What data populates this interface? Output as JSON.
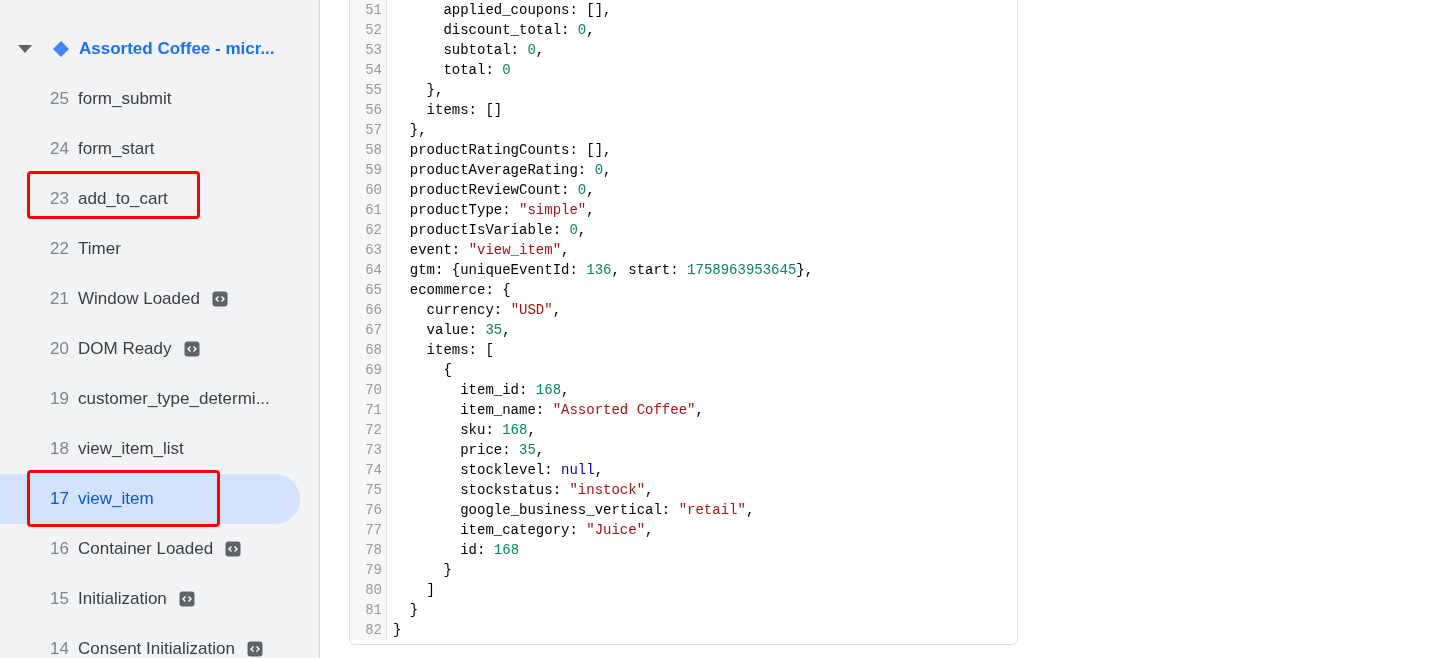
{
  "sidebar": {
    "items": [
      {
        "kind": "group",
        "label": "Assorted Coffee - micr...",
        "expanded": true
      },
      {
        "kind": "event",
        "number": "25",
        "label": "form_submit",
        "selected": false,
        "annotated": false,
        "code_icon": false
      },
      {
        "kind": "event",
        "number": "24",
        "label": "form_start",
        "selected": false,
        "annotated": false,
        "code_icon": false
      },
      {
        "kind": "event",
        "number": "23",
        "label": "add_to_cart",
        "selected": false,
        "annotated": true,
        "code_icon": false
      },
      {
        "kind": "event",
        "number": "22",
        "label": "Timer",
        "selected": false,
        "annotated": false,
        "code_icon": false
      },
      {
        "kind": "event",
        "number": "21",
        "label": "Window Loaded",
        "selected": false,
        "annotated": false,
        "code_icon": true
      },
      {
        "kind": "event",
        "number": "20",
        "label": "DOM Ready",
        "selected": false,
        "annotated": false,
        "code_icon": true
      },
      {
        "kind": "event",
        "number": "19",
        "label": "customer_type_determi...",
        "selected": false,
        "annotated": false,
        "code_icon": false
      },
      {
        "kind": "event",
        "number": "18",
        "label": "view_item_list",
        "selected": false,
        "annotated": false,
        "code_icon": false
      },
      {
        "kind": "event",
        "number": "17",
        "label": "view_item",
        "selected": true,
        "annotated": true,
        "code_icon": false
      },
      {
        "kind": "event",
        "number": "16",
        "label": "Container Loaded",
        "selected": false,
        "annotated": false,
        "code_icon": true
      },
      {
        "kind": "event",
        "number": "15",
        "label": "Initialization",
        "selected": false,
        "annotated": false,
        "code_icon": true
      },
      {
        "kind": "event",
        "number": "14",
        "label": "Consent Initialization",
        "selected": false,
        "annotated": false,
        "code_icon": true
      }
    ]
  },
  "code": {
    "lines": [
      {
        "n": "51",
        "tokens": [
          {
            "kind": "plain",
            "text": "      applied_coupons: [],"
          }
        ]
      },
      {
        "n": "52",
        "tokens": [
          {
            "kind": "plain",
            "text": "      discount_total: "
          },
          {
            "kind": "number",
            "text": "0"
          },
          {
            "kind": "plain",
            "text": ","
          }
        ]
      },
      {
        "n": "53",
        "tokens": [
          {
            "kind": "plain",
            "text": "      subtotal: "
          },
          {
            "kind": "number",
            "text": "0"
          },
          {
            "kind": "plain",
            "text": ","
          }
        ]
      },
      {
        "n": "54",
        "tokens": [
          {
            "kind": "plain",
            "text": "      total: "
          },
          {
            "kind": "number",
            "text": "0"
          }
        ]
      },
      {
        "n": "55",
        "tokens": [
          {
            "kind": "plain",
            "text": "    },"
          }
        ]
      },
      {
        "n": "56",
        "tokens": [
          {
            "kind": "plain",
            "text": "    items: []"
          }
        ]
      },
      {
        "n": "57",
        "tokens": [
          {
            "kind": "plain",
            "text": "  },"
          }
        ]
      },
      {
        "n": "58",
        "tokens": [
          {
            "kind": "plain",
            "text": "  productRatingCounts: [],"
          }
        ]
      },
      {
        "n": "59",
        "tokens": [
          {
            "kind": "plain",
            "text": "  productAverageRating: "
          },
          {
            "kind": "number",
            "text": "0"
          },
          {
            "kind": "plain",
            "text": ","
          }
        ]
      },
      {
        "n": "60",
        "tokens": [
          {
            "kind": "plain",
            "text": "  productReviewCount: "
          },
          {
            "kind": "number",
            "text": "0"
          },
          {
            "kind": "plain",
            "text": ","
          }
        ]
      },
      {
        "n": "61",
        "tokens": [
          {
            "kind": "plain",
            "text": "  productType: "
          },
          {
            "kind": "string",
            "text": "\"simple\""
          },
          {
            "kind": "plain",
            "text": ","
          }
        ]
      },
      {
        "n": "62",
        "tokens": [
          {
            "kind": "plain",
            "text": "  productIsVariable: "
          },
          {
            "kind": "number",
            "text": "0"
          },
          {
            "kind": "plain",
            "text": ","
          }
        ]
      },
      {
        "n": "63",
        "tokens": [
          {
            "kind": "plain",
            "text": "  event: "
          },
          {
            "kind": "string",
            "text": "\"view_item\""
          },
          {
            "kind": "plain",
            "text": ","
          }
        ]
      },
      {
        "n": "64",
        "tokens": [
          {
            "kind": "plain",
            "text": "  gtm: {uniqueEventId: "
          },
          {
            "kind": "number",
            "text": "136"
          },
          {
            "kind": "plain",
            "text": ", start: "
          },
          {
            "kind": "number",
            "text": "1758963953645"
          },
          {
            "kind": "plain",
            "text": "},"
          }
        ]
      },
      {
        "n": "65",
        "tokens": [
          {
            "kind": "plain",
            "text": "  ecommerce: {"
          }
        ]
      },
      {
        "n": "66",
        "tokens": [
          {
            "kind": "plain",
            "text": "    currency: "
          },
          {
            "kind": "string",
            "text": "\"USD\""
          },
          {
            "kind": "plain",
            "text": ","
          }
        ]
      },
      {
        "n": "67",
        "tokens": [
          {
            "kind": "plain",
            "text": "    value: "
          },
          {
            "kind": "number",
            "text": "35"
          },
          {
            "kind": "plain",
            "text": ","
          }
        ]
      },
      {
        "n": "68",
        "tokens": [
          {
            "kind": "plain",
            "text": "    items: ["
          }
        ]
      },
      {
        "n": "69",
        "tokens": [
          {
            "kind": "plain",
            "text": "      {"
          }
        ]
      },
      {
        "n": "70",
        "tokens": [
          {
            "kind": "plain",
            "text": "        item_id: "
          },
          {
            "kind": "number",
            "text": "168"
          },
          {
            "kind": "plain",
            "text": ","
          }
        ]
      },
      {
        "n": "71",
        "tokens": [
          {
            "kind": "plain",
            "text": "        item_name: "
          },
          {
            "kind": "string",
            "text": "\"Assorted Coffee\""
          },
          {
            "kind": "plain",
            "text": ","
          }
        ]
      },
      {
        "n": "72",
        "tokens": [
          {
            "kind": "plain",
            "text": "        sku: "
          },
          {
            "kind": "number",
            "text": "168"
          },
          {
            "kind": "plain",
            "text": ","
          }
        ]
      },
      {
        "n": "73",
        "tokens": [
          {
            "kind": "plain",
            "text": "        price: "
          },
          {
            "kind": "number",
            "text": "35"
          },
          {
            "kind": "plain",
            "text": ","
          }
        ]
      },
      {
        "n": "74",
        "tokens": [
          {
            "kind": "plain",
            "text": "        stocklevel: "
          },
          {
            "kind": "null",
            "text": "null"
          },
          {
            "kind": "plain",
            "text": ","
          }
        ]
      },
      {
        "n": "75",
        "tokens": [
          {
            "kind": "plain",
            "text": "        stockstatus: "
          },
          {
            "kind": "string",
            "text": "\"instock\""
          },
          {
            "kind": "plain",
            "text": ","
          }
        ]
      },
      {
        "n": "76",
        "tokens": [
          {
            "kind": "plain",
            "text": "        google_business_vertical: "
          },
          {
            "kind": "string",
            "text": "\"retail\""
          },
          {
            "kind": "plain",
            "text": ","
          }
        ]
      },
      {
        "n": "77",
        "tokens": [
          {
            "kind": "plain",
            "text": "        item_category: "
          },
          {
            "kind": "string",
            "text": "\"Juice\""
          },
          {
            "kind": "plain",
            "text": ","
          }
        ]
      },
      {
        "n": "78",
        "tokens": [
          {
            "kind": "plain",
            "text": "        id: "
          },
          {
            "kind": "number",
            "text": "168"
          }
        ]
      },
      {
        "n": "79",
        "tokens": [
          {
            "kind": "plain",
            "text": "      }"
          }
        ]
      },
      {
        "n": "80",
        "tokens": [
          {
            "kind": "plain",
            "text": "    ]"
          }
        ]
      },
      {
        "n": "81",
        "tokens": [
          {
            "kind": "plain",
            "text": "  }"
          }
        ]
      },
      {
        "n": "82",
        "tokens": [
          {
            "kind": "plain",
            "text": "}"
          }
        ]
      }
    ]
  }
}
